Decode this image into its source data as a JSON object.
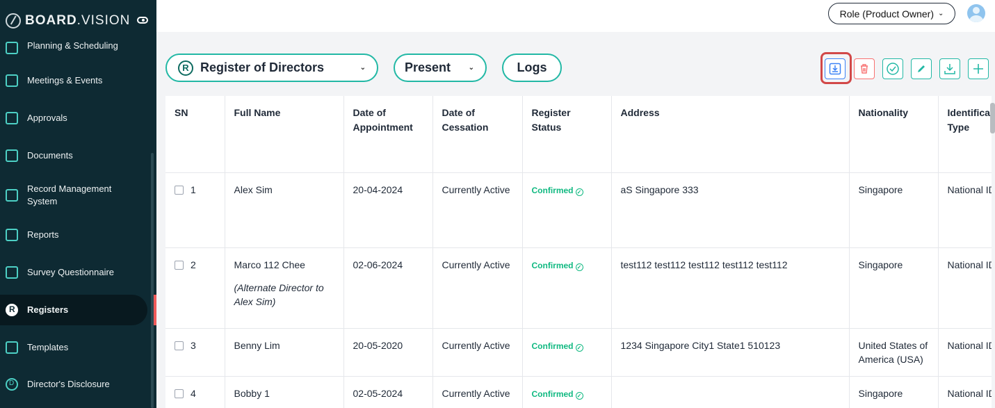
{
  "brand": {
    "logo_bold": "BOARD",
    "logo_rest": ".VISION"
  },
  "sidebar": {
    "items": [
      {
        "label": "Planning & Scheduling",
        "icon": "calendar-grid-icon"
      },
      {
        "label": "Meetings & Events",
        "icon": "calendar-check-icon"
      },
      {
        "label": "Approvals",
        "icon": "document-list-icon"
      },
      {
        "label": "Documents",
        "icon": "documents-icon"
      },
      {
        "label": "Record Management System",
        "icon": "record-icon"
      },
      {
        "label": "Reports",
        "icon": "report-icon"
      },
      {
        "label": "Survey Questionnaire",
        "icon": "survey-icon"
      },
      {
        "label": "Registers",
        "icon": "registers-icon",
        "active": true
      },
      {
        "label": "Templates",
        "icon": "template-icon"
      },
      {
        "label": "Director's Disclosure",
        "icon": "disclosure-icon"
      }
    ]
  },
  "header": {
    "role_label": "Role (Product Owner)"
  },
  "toolbar": {
    "register_select": "Register of Directors",
    "present_select": "Present",
    "logs_label": "Logs",
    "actions": [
      "import-icon",
      "delete-icon",
      "confirm-icon",
      "edit-icon",
      "download-icon",
      "add-icon"
    ]
  },
  "table": {
    "columns": [
      "SN",
      "Full Name",
      "Date of Appointment",
      "Date of Cessation",
      "Register Status",
      "Address",
      "Nationality",
      "Identification Type"
    ],
    "rows": [
      {
        "sn": "1",
        "name": "Alex Sim",
        "note": "",
        "appointment": "20-04-2024",
        "cessation": "Currently Active",
        "status": "Confirmed",
        "address": "aS Singapore 333",
        "nationality": "Singapore",
        "id_type": "National ID"
      },
      {
        "sn": "2",
        "name": "Marco 112 Chee",
        "note": "(Alternate Director to Alex Sim)",
        "appointment": "02-06-2024",
        "cessation": "Currently Active",
        "status": "Confirmed",
        "address": "test112 test112 test112 test112 test112",
        "nationality": "Singapore",
        "id_type": "National ID"
      },
      {
        "sn": "3",
        "name": "Benny Lim",
        "note": "",
        "appointment": "20-05-2020",
        "cessation": "Currently Active",
        "status": "Confirmed",
        "address": "1234 Singapore City1 State1 510123",
        "nationality": "United States of America (USA)",
        "id_type": "National ID"
      },
      {
        "sn": "4",
        "name": "Bobby 1",
        "note": "",
        "appointment": "02-05-2024",
        "cessation": "Currently Active",
        "status": "Confirmed",
        "address": "",
        "nationality": "Singapore",
        "id_type": "National ID"
      }
    ]
  },
  "colors": {
    "sidebar_bg": "#0e2a33",
    "accent": "#22b8a5",
    "status_green": "#10b981",
    "highlight": "#d24848"
  }
}
